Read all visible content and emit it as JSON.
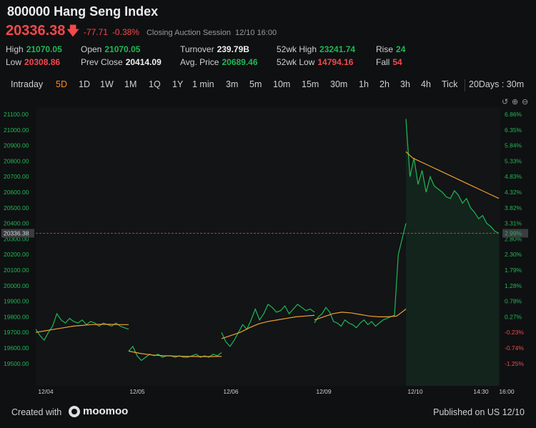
{
  "header": {
    "title": "800000 Hang Seng Index",
    "price": "20336.38",
    "change": "-77.71",
    "change_pct": "-0.38%",
    "session": "Closing Auction Session",
    "session_time": "12/10 16:00",
    "down_color": "#f2494b",
    "up_color": "#1fb855"
  },
  "stats": {
    "high_label": "High",
    "high": "21070.05",
    "low_label": "Low",
    "low": "20308.86",
    "open_label": "Open",
    "open": "21070.05",
    "prev_close_label": "Prev Close",
    "prev_close": "20414.09",
    "turnover_label": "Turnover",
    "turnover": "239.79B",
    "avg_price_label": "Avg. Price",
    "avg_price": "20689.46",
    "wk52_high_label": "52wk High",
    "wk52_high": "23241.74",
    "wk52_low_label": "52wk Low",
    "wk52_low": "14794.16",
    "rise_label": "Rise",
    "rise": "24",
    "fall_label": "Fall",
    "fall": "54"
  },
  "tabs": [
    "Intraday",
    "5D",
    "1D",
    "1W",
    "1M",
    "1Q",
    "1Y",
    "1 min",
    "3m",
    "5m",
    "10m",
    "15m",
    "30m",
    "1h",
    "2h",
    "3h",
    "4h",
    "Tick",
    "20Days : 30m"
  ],
  "active_tab": "5D",
  "chart_controls": [
    "undo-icon",
    "zoom-in-icon",
    "zoom-out-icon"
  ],
  "watermark": "moomoo",
  "footer": {
    "created_with": "Created with",
    "brand": "moomoo",
    "published": "Published on US 12/10"
  },
  "chart_data": {
    "type": "line",
    "y_ticks": [
      "21100.00",
      "21000.00",
      "20900.00",
      "20800.00",
      "20700.00",
      "20600.00",
      "20500.00",
      "20400.00",
      "20300.00",
      "20200.00",
      "20100.00",
      "20000.00",
      "19900.00",
      "19800.00",
      "19700.00",
      "19600.00",
      "19500.00"
    ],
    "y_pct_ticks": [
      "6.86%",
      "6.35%",
      "5.84%",
      "5.33%",
      "4.83%",
      "4.32%",
      "3.82%",
      "3.31%",
      "2.80%",
      "2.30%",
      "1.79%",
      "1.28%",
      "0.78%",
      "0.27%",
      "-0.23%",
      "-0.74%",
      "-1.25%"
    ],
    "x_ticks": [
      "12/04",
      "12/05",
      "12/06",
      "12/09",
      "12/10",
      "14:30",
      "16:00"
    ],
    "ylim": [
      19450,
      21150
    ],
    "current_price_label": "20336.38",
    "current_pct_label": "2.99%",
    "current_price": 20336.38,
    "price_color": "#1fb855",
    "avg_color": "#f0a030",
    "series": [
      {
        "name": "Price",
        "days": [
          {
            "day": "12/04",
            "values": [
              19720,
              19680,
              19650,
              19700,
              19740,
              19820,
              19780,
              19760,
              19790,
              19770,
              19760,
              19780,
              19750,
              19770,
              19760,
              19740,
              19760,
              19750,
              19740,
              19760,
              19740,
              19730,
              19720
            ]
          },
          {
            "day": "12/05",
            "values": [
              19580,
              19610,
              19550,
              19520,
              19540,
              19560,
              19550,
              19560,
              19540,
              19550,
              19550,
              19540,
              19550,
              19540,
              19540,
              19550,
              19560,
              19540,
              19550,
              19540,
              19560,
              19550,
              19570
            ]
          },
          {
            "day": "12/06",
            "values": [
              19700,
              19640,
              19610,
              19650,
              19700,
              19750,
              19720,
              19780,
              19850,
              19780,
              19820,
              19880,
              19860,
              19830,
              19840,
              19870,
              19820,
              19850,
              19880,
              19860,
              19840,
              19850,
              19830
            ]
          },
          {
            "day": "12/09",
            "values": [
              19760,
              19800,
              19820,
              19860,
              19830,
              19770,
              19760,
              19740,
              19780,
              19760,
              19750,
              19730,
              19760,
              19780,
              19750,
              19770,
              19740,
              19760,
              19780,
              19790,
              19800,
              19810,
              20200,
              20300,
              20400
            ]
          },
          {
            "day": "12/10",
            "values": [
              21070,
              20700,
              20820,
              20650,
              20740,
              20600,
              20700,
              20640,
              20620,
              20600,
              20570,
              20560,
              20610,
              20580,
              20530,
              20560,
              20500,
              20470,
              20430,
              20450,
              20400,
              20380,
              20350,
              20336.38
            ]
          }
        ]
      },
      {
        "name": "Avg. Price",
        "days": [
          {
            "day": "12/04",
            "values": [
              19700,
              19710,
              19720,
              19730,
              19740,
              19745,
              19750,
              19752,
              19752,
              19750,
              19750
            ]
          },
          {
            "day": "12/05",
            "values": [
              19580,
              19565,
              19555,
              19550,
              19548,
              19546,
              19545,
              19545,
              19546
            ]
          },
          {
            "day": "12/06",
            "values": [
              19660,
              19680,
              19700,
              19730,
              19755,
              19770,
              19780,
              19790,
              19800,
              19805,
              19810
            ]
          },
          {
            "day": "12/09",
            "values": [
              19780,
              19800,
              19820,
              19830,
              19825,
              19815,
              19805,
              19800,
              19800,
              19805,
              19850
            ]
          },
          {
            "day": "12/10",
            "values": [
              20860,
              20820,
              20800,
              20780,
              20760,
              20740,
              20720,
              20700,
              20680,
              20660,
              20640,
              20620,
              20600,
              20580,
              20560
            ]
          }
        ]
      }
    ]
  }
}
